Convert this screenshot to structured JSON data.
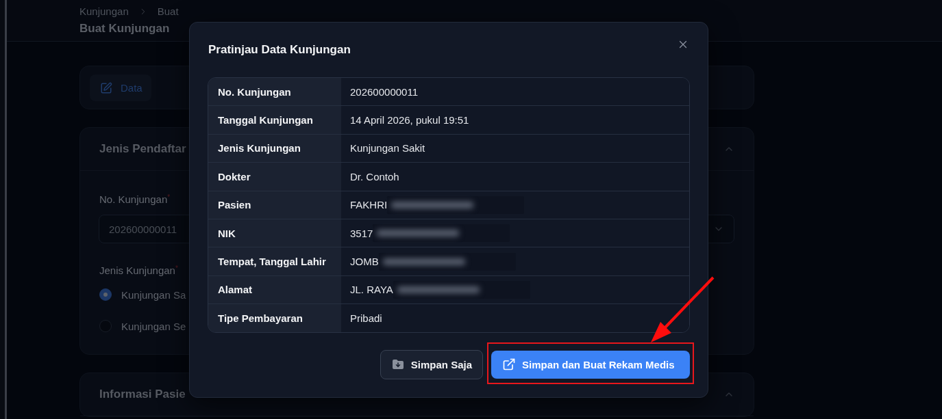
{
  "breadcrumb": [
    "Kunjungan",
    "Buat"
  ],
  "page_title": "Buat Kunjungan",
  "tabs": [
    {
      "label": "Data",
      "selected": true
    }
  ],
  "sections": [
    {
      "title": "Jenis Pendaftar",
      "expanded": true
    },
    {
      "title": "Informasi Pasie",
      "expanded": true
    }
  ],
  "form": {
    "visit_number": {
      "label": "No. Kunjungan$^{*}$",
      "value": "202600000011"
    },
    "visit_type": {
      "label": "Jenis Kunjungan$^{*}$",
      "options": [
        {
          "label": "Kunjungan Sa",
          "selected": true
        },
        {
          "label": "Kunjungan Se",
          "selected": false
        }
      ]
    }
  },
  "dialog": {
    "title": "Pratinjau Data Kunjungan",
    "rows": [
      {
        "label": "No. Kunjungan",
        "value": "202600000011",
        "redacted": false
      },
      {
        "label": "Tanggal Kunjungan",
        "value": "14 April 2026, pukul 19:51",
        "redacted": false
      },
      {
        "label": "Jenis Kunjungan",
        "value": "Kunjungan Sakit",
        "redacted": false
      },
      {
        "label": "Dokter",
        "value": "Dr. Contoh",
        "redacted": false
      },
      {
        "label": "Pasien",
        "value": "FAKHRI",
        "redacted": true
      },
      {
        "label": "NIK",
        "value": "3517",
        "redacted": true
      },
      {
        "label": "Tempat, Tanggal Lahir",
        "value": "JOMB",
        "redacted": true
      },
      {
        "label": "Alamat",
        "value": "JL. RAYA",
        "redacted": true
      },
      {
        "label": "Tipe Pembayaran",
        "value": "Pribadi",
        "redacted": false
      }
    ],
    "buttons": [
      {
        "label": "Simpan Saja",
        "kind": "secondary"
      },
      {
        "label": "Simpan dan Buat Rekam Medis",
        "kind": "primary"
      }
    ]
  }
}
